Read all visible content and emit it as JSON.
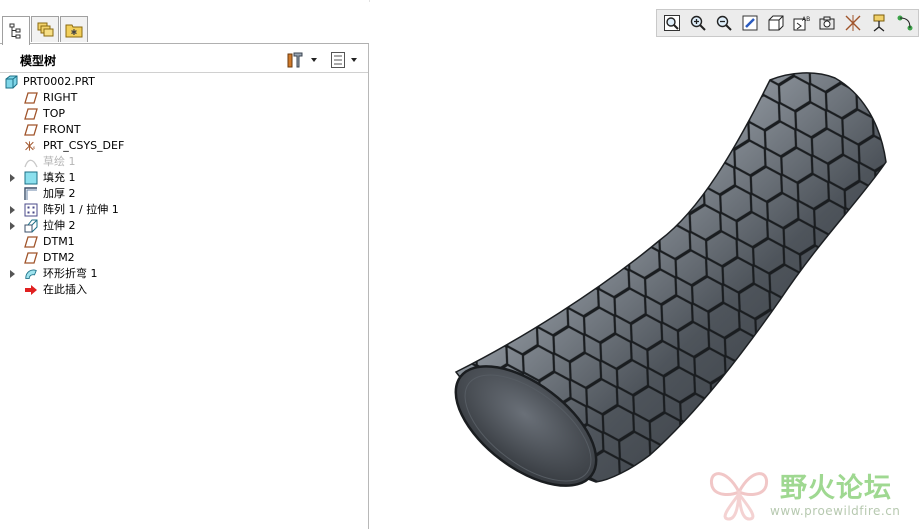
{
  "model_tree": {
    "title": "模型树",
    "tabs": [
      {
        "icon": "model-tree-icon"
      },
      {
        "icon": "layers-icon"
      },
      {
        "icon": "favorites-folder-icon"
      }
    ],
    "items": [
      {
        "label": "PRT0002.PRT",
        "icon": "part-icon",
        "expandable": false,
        "dim": false
      },
      {
        "label": "RIGHT",
        "icon": "datum-plane-icon",
        "expandable": false,
        "dim": false
      },
      {
        "label": "TOP",
        "icon": "datum-plane-icon",
        "expandable": false,
        "dim": false
      },
      {
        "label": "FRONT",
        "icon": "datum-plane-icon",
        "expandable": false,
        "dim": false
      },
      {
        "label": "PRT_CSYS_DEF",
        "icon": "csys-icon",
        "expandable": false,
        "dim": false
      },
      {
        "label": "草绘 1",
        "icon": "sketch-icon",
        "expandable": false,
        "dim": true
      },
      {
        "label": "填充 1",
        "icon": "fill-icon",
        "expandable": true,
        "dim": false
      },
      {
        "label": "加厚 2",
        "icon": "thicken-icon",
        "expandable": false,
        "dim": false
      },
      {
        "label": "阵列 1 / 拉伸 1",
        "icon": "pattern-icon",
        "expandable": true,
        "dim": false
      },
      {
        "label": "拉伸 2",
        "icon": "extrude-icon",
        "expandable": true,
        "dim": false
      },
      {
        "label": "DTM1",
        "icon": "datum-plane-icon",
        "expandable": false,
        "dim": false
      },
      {
        "label": "DTM2",
        "icon": "datum-plane-icon",
        "expandable": false,
        "dim": false
      },
      {
        "label": "环形折弯 1",
        "icon": "toroidal-bend-icon",
        "expandable": true,
        "dim": false
      },
      {
        "label": "在此插入",
        "icon": "insert-here-arrow-icon",
        "expandable": false,
        "dim": false
      }
    ]
  },
  "view_toolbar": {
    "buttons": [
      {
        "icon": "refit-icon"
      },
      {
        "icon": "zoom-in-icon"
      },
      {
        "icon": "zoom-out-icon"
      },
      {
        "icon": "repaint-icon"
      },
      {
        "icon": "display-style-icon"
      },
      {
        "icon": "saved-views-icon"
      },
      {
        "icon": "view-manager-icon"
      },
      {
        "icon": "datum-display-icon"
      },
      {
        "icon": "annotation-display-icon"
      },
      {
        "icon": "spin-center-icon"
      }
    ]
  },
  "watermark": {
    "text": "野火论坛",
    "url": "www.proewildfire.cn"
  },
  "colors": {
    "model_dark": "#33373c",
    "model_mid": "#5d636b",
    "model_light": "#9aa1a9",
    "watermark_green": "#8fd27e"
  }
}
